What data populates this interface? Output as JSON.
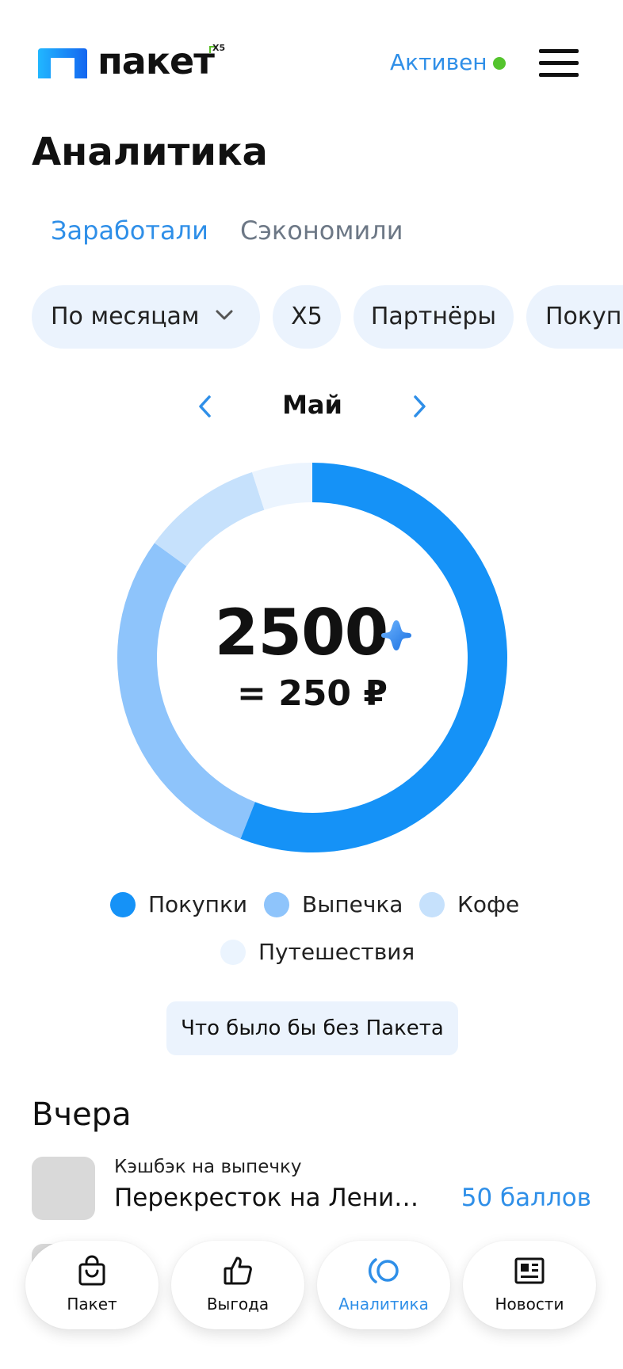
{
  "header": {
    "logo_text": "пакет",
    "logo_badge": "X5",
    "status_text": "Активен",
    "colors": {
      "accent": "#2f8fe8",
      "status_dot": "#54c42d"
    }
  },
  "page_title": "Аналитика",
  "tabs": [
    {
      "label": "Заработали",
      "active": true
    },
    {
      "label": "Сэкономили",
      "active": false
    }
  ],
  "filters": {
    "period": "По месяцам",
    "chips": [
      "X5",
      "Партнёры",
      "Покупки"
    ]
  },
  "month": {
    "label": "Май"
  },
  "summary": {
    "points": "2500",
    "rub": "= 250 ₽"
  },
  "chart_data": {
    "type": "pie",
    "categories": [
      "Покупки",
      "Выпечка",
      "Кофе",
      "Путешествия"
    ],
    "values": [
      56,
      29,
      10,
      5
    ],
    "colors": [
      "#1592f7",
      "#8ec4fb",
      "#c6e1fc",
      "#ebf4fe"
    ]
  },
  "legend": [
    {
      "label": "Покупки"
    },
    {
      "label": "Выпечка"
    },
    {
      "label": "Кофе"
    },
    {
      "label": "Путешествия"
    }
  ],
  "without_button": "Что было бы без Пакета",
  "history": {
    "section_title": "Вчера",
    "transactions": [
      {
        "subtitle": "Кэшбэк на выпечку",
        "title": "Перекресток на Ленина...",
        "amount": "50 баллов"
      }
    ]
  },
  "nav": [
    {
      "label": "Пакет",
      "icon": "bag-icon",
      "active": false
    },
    {
      "label": "Выгода",
      "icon": "thumbs-up-icon",
      "active": false
    },
    {
      "label": "Аналитика",
      "icon": "analytics-icon",
      "active": true
    },
    {
      "label": "Новости",
      "icon": "news-icon",
      "active": false
    }
  ]
}
